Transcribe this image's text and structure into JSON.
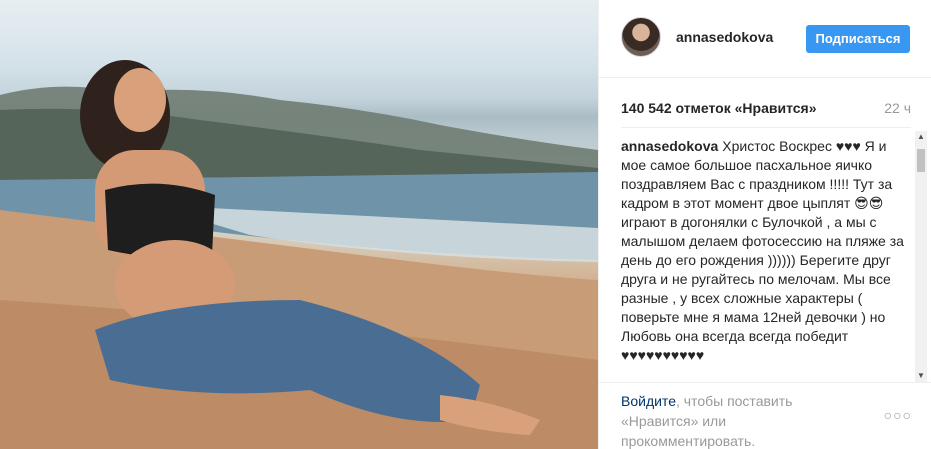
{
  "post": {
    "username": "annasedokova",
    "follow_label": "Подписаться",
    "likes": "140 542 отметок «Нравится»",
    "time_ago": "22 ч",
    "caption_user": "annasedokova",
    "caption_text": "Христос Воскрес ♥♥♥ Я и мое самое большое пасхальное яичко поздравляем Вас с праздником !!!!! Тут за кадром в этот момент двое цыплят 😎😎 играют в догонялки с Булочкой , а мы с малышом делаем фотосессию на пляже за день до его рождения )))))) Берегите друг друга и не ругайтесь по мелочам. Мы все разные , у всех сложные характеры ( поверьте мне я мама 12ней девочки ) но Любовь она всегда всегда победит ♥♥♥♥♥♥♥♥♥♥",
    "login_link": "Войдите",
    "login_rest": ", чтобы поставить «Нравится» или прокомментировать.",
    "more_options": "○○○"
  },
  "icons": {
    "scroll_up": "scroll-up-arrow-icon",
    "scroll_down": "scroll-down-arrow-icon",
    "more": "more-options-icon"
  },
  "colors": {
    "accent": "#3897f0",
    "link": "#003569",
    "muted": "#999999",
    "text": "#262626"
  }
}
